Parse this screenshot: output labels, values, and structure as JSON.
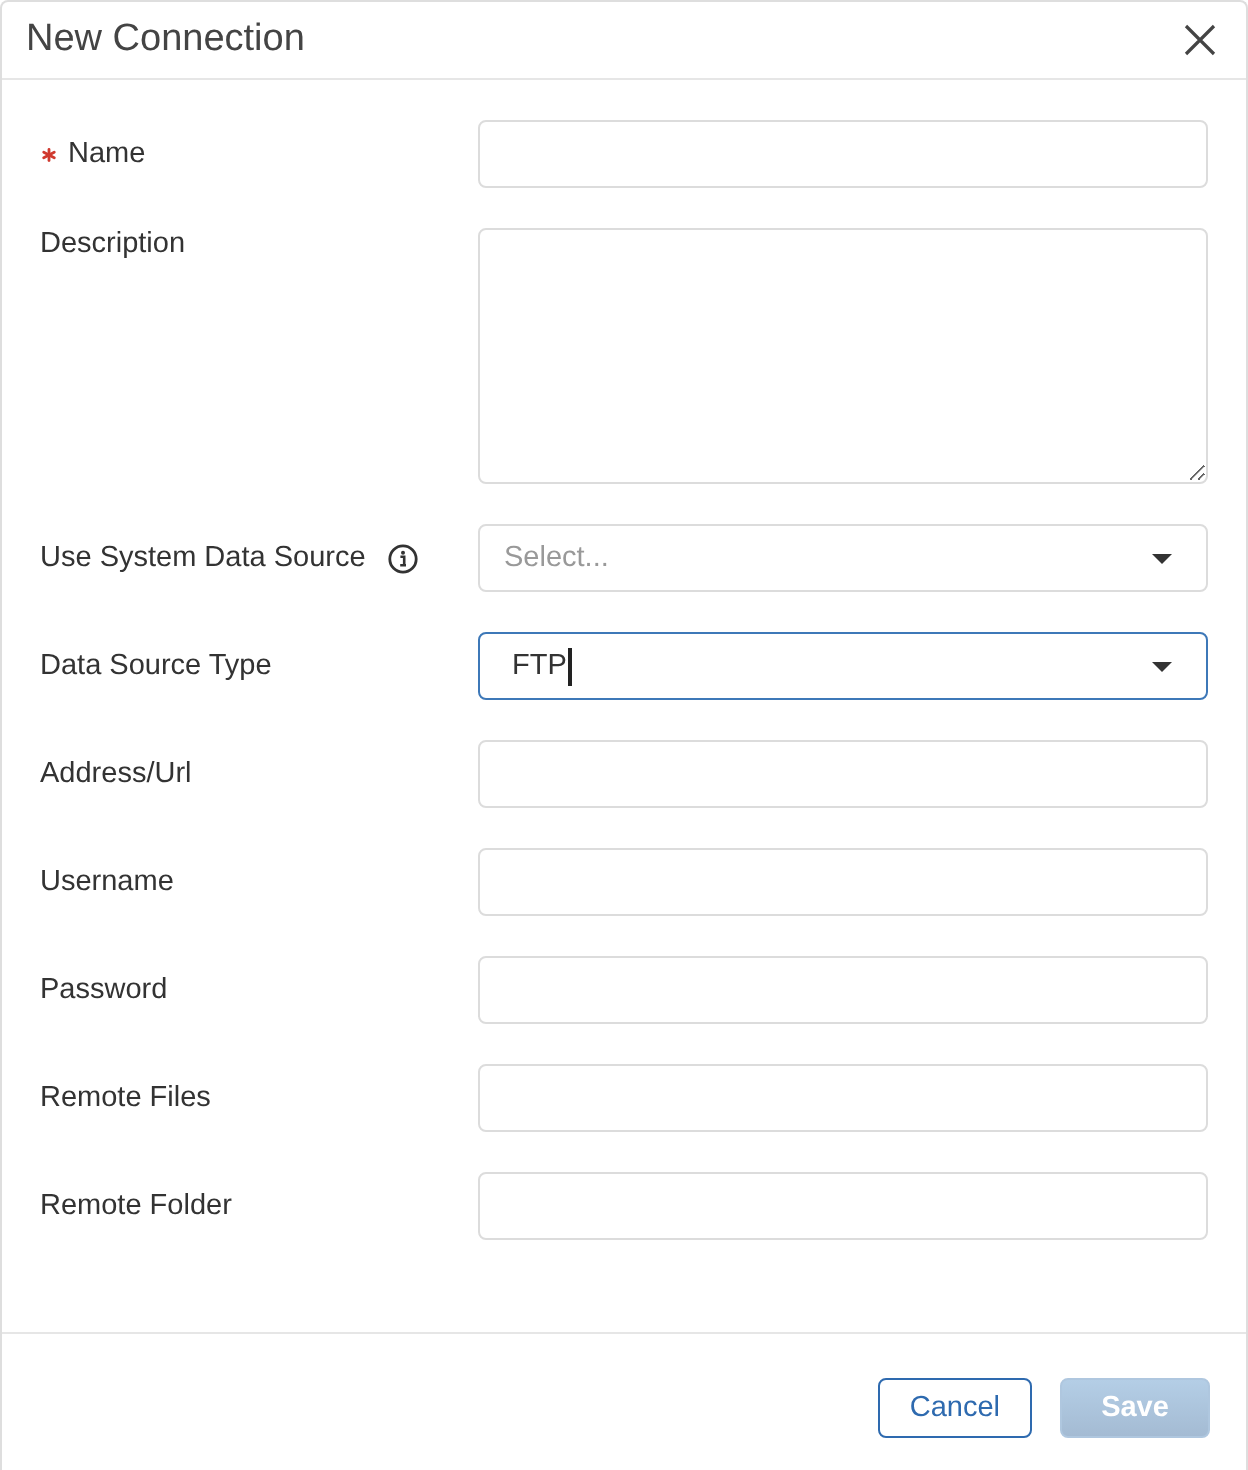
{
  "dialog": {
    "title": "New Connection"
  },
  "fields": [
    {
      "kind": "text",
      "label": "Name",
      "required": true,
      "info": false,
      "focused": false
    },
    {
      "kind": "textarea",
      "label": "Description",
      "required": false,
      "info": false,
      "focused": false
    },
    {
      "kind": "select",
      "label": "Use System Data Source",
      "required": false,
      "info": true,
      "focused": false,
      "placeholder": "Select..."
    },
    {
      "kind": "select",
      "label": "Data Source Type",
      "required": false,
      "info": false,
      "focused": true,
      "value": "FTP"
    },
    {
      "kind": "text",
      "label": "Address/Url",
      "required": false,
      "info": false,
      "focused": false
    },
    {
      "kind": "text",
      "label": "Username",
      "required": false,
      "info": false,
      "focused": false
    },
    {
      "kind": "text",
      "label": "Password",
      "required": false,
      "info": false,
      "focused": false
    },
    {
      "kind": "text",
      "label": "Remote Files",
      "required": false,
      "info": false,
      "focused": false
    },
    {
      "kind": "text",
      "label": "Remote Folder",
      "required": false,
      "info": false,
      "focused": false
    }
  ],
  "buttons": [
    {
      "label": "Cancel",
      "kind": "secondary",
      "disabled": false
    },
    {
      "label": "Save",
      "kind": "primary",
      "disabled": true
    }
  ]
}
